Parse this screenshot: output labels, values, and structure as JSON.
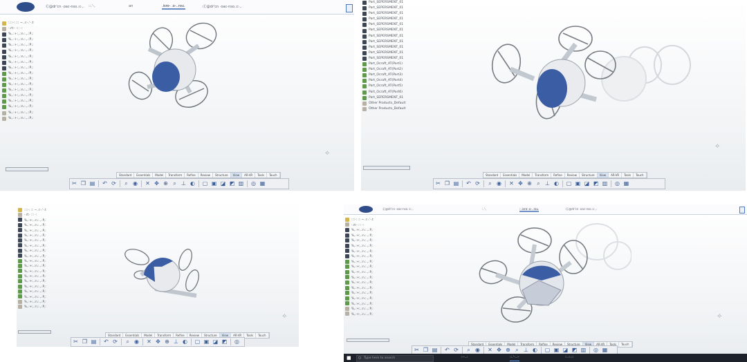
{
  "colors": {
    "accent": "#2f4d8a",
    "drone_blue": "#3a5da3",
    "drone_gray": "#dfe2e6",
    "tree_part_icon": "#3d4654",
    "tree_sub_icon": "#5f9a4b"
  },
  "icons": [
    "catia-compass-icon",
    "part-icon",
    "product-icon",
    "cut-icon",
    "copy-icon",
    "paste-icon",
    "undo-icon",
    "redo-icon",
    "update-icon",
    "zoom-icon",
    "fit-all-icon",
    "pan-icon",
    "rotate-icon",
    "normal-view-icon",
    "render-icon",
    "hide-show-icon",
    "windows-start-icon",
    "search-icon"
  ],
  "panel1": {
    "tabs": [
      "Ⓒ@dr'cn ·oac-nso.:c·,.",
      "::.'-,",
      "an ",
      ".isro- .o-..rou.",
      ":Ⓒ@dr'cn ·oac-nso.:c·,."
    ],
    "tree": [
      "::::-: ::: ~..r:-.'-.t",
      "-.rt:- ::: -: ",
      "  %,.:+:,.:n.:.,.:P,:",
      "  %,.:+:,.:n.:.,.:P,:",
      "  %,.:+:,.:n.:.,.:P,:",
      "  %,.:+:,.:n.:.,.:P,:",
      "  %,.:+:,.:n.:.,.:P,:",
      "  %,.:+:,.:n.:.,.:P,:",
      "  %,.:+:,.:n.:.,.:P,:",
      "  %,.:+:,.:n.:.,.:P,:",
      "  %,.:+:,.:n.:.,.:P,:",
      "  %,.:+:,.:n.:.,.:P,:",
      "  %,.:+:,.:n.:.,.:P,:",
      "  %,.:+:,.:n.:.,.:P,:",
      "  %,.:+:,.:n.:.,.:P,:",
      "  %,.:+:,.:n.:.,.:P,:",
      "  %,.:+:,.:n.:.,.:P,:",
      "  %,.:+:,.:n.:.,.:P,:"
    ],
    "workbench_tabs": [
      "Standard",
      "Essentials",
      "Model",
      "Transform",
      "Refine",
      "Review",
      "Structure",
      "View",
      "AR-VR",
      "Tools",
      "Touch"
    ]
  },
  "panel2": {
    "tree": [
      "Part_SEPERSMENT_01",
      "Part_SEPERSMENT_01",
      "Part_SEPERSMENT_01",
      "Part_SEPERSMENT_01",
      "Part_SEPERSMENT_01",
      "Part_SEPERSMENT_01",
      "Part_SEPERSMENT_01",
      "Part_SEPERSMENT_01",
      "Part_SEPERSMENT_01",
      "Part_SEPERSMENT_01",
      "Part_SEPERSMENT_01",
      "Part_Ocraft_AT(Part1)",
      "Part_Ocraft_AT(Part2)",
      "Part_Ocraft_AT(Part3)",
      "Part_Ocraft_AT(Part4)",
      "Part_Ocraft_AT(Part5)",
      "Part_Ocraft_AT(Part6)",
      "Part_SEPERSMENT_01",
      "Other Products_Default",
      "Other Products_Default"
    ],
    "workbench_tabs": [
      "Standard",
      "Essentials",
      "Model",
      "Transform",
      "Refine",
      "Review",
      "Structure",
      "View",
      "AR-VR",
      "Tools",
      "Touch"
    ]
  },
  "panel3": {
    "tree": [
      "::::-: ::: ~..r:-.'-.t",
      "-.rt:- ::: -: ",
      "  %,.:+:,.:n.:.,.:P,:",
      "  %,.:+:,.:n.:.,.:P,:",
      "  %,.:+:,.:n.:.,.:P,:",
      "  %,.:+:,.:n.:.,.:P,:",
      "  %,.:+:,.:n.:.,.:P,:",
      "  %,.:+:,.:n.:.,.:P,:",
      "  %,.:+:,.:n.:.,.:P,:",
      "  %,.:+:,.:n.:.,.:P,:",
      "  %,.:+:,.:n.:.,.:P,:",
      "  %,.:+:,.:n.:.,.:P,:",
      "  %,.:+:,.:n.:.,.:P,:",
      "  %,.:+:,.:n.:.,.:P,:",
      "  %,.:+:,.:n.:.,.:P,:",
      "  %,.:+:,.:n.:.,.:P,:",
      "  %,.:+:,.:n.:.,.:P,:",
      "  %,.:+:,.:n.:.,.:P,:",
      "  %,.:+:,.:n.:.,.:P,:",
      "  %,.:+:,.:n.:.,.:P,:"
    ],
    "workbench_tabs": [
      "Standard",
      "Essentials",
      "Model",
      "Transform",
      "Refine",
      "Review",
      "Structure",
      "View",
      "AR-VR",
      "Tools",
      "Touch"
    ]
  },
  "panel4": {
    "tabs": [
      "Ⓒ@dr'cn ·oac-nso.:c·,.",
      ":.'-,",
      "::.isro-.o-..rou.",
      ":Ⓒ@dr'cn ·oac-nso.:c·,."
    ],
    "tree": [
      "::::-: ::: ~..r:-.'-.t",
      "-.rt:- ::: -: ",
      "  %,.:+:,.:n.:.,.:P,:",
      "  %,.:+:,.:n.:.,.:P,:",
      "  %,.:+:,.:n.:.,.:P,:",
      "  %,.:+:,.:n.:.,.:P,:",
      "  %,.:+:,.:n.:.,.:P,:",
      "  %,.:+:,.:n.:.,.:P,:",
      "  %,.:+:,.:n.:.,.:P,:",
      "  %,.:+:,.:n.:.,.:P,:",
      "  %,.:+:,.:n.:.,.:P,:",
      "  %,.:+:,.:n.:.,.:P,:",
      "  %,.:+:,.:n.:.,.:P,:",
      "  %,.:+:,.:n.:.,.:P,:",
      "  %,.:+:,.:n.:.,.:P,:",
      "  %,.:+:,.:n.:.,.:P,:",
      "  %,.:+:,.:n.:.,.:P,:",
      "  %,.:+:,.:n.:.,.:P,:",
      "  %,.:+:,.:n.:.,.:P,:"
    ],
    "workbench_tabs": [
      "Standard",
      "Essentials",
      "Model",
      "Transform",
      "Refine",
      "Review",
      "Structure",
      "View",
      "AR-VR",
      "Tools",
      "Touch"
    ],
    "taskbar": {
      "search_placeholder": "Type here to search",
      "items": [
        ":--..:",
        "::.'-..:-",
        "::.::.::"
      ]
    }
  }
}
